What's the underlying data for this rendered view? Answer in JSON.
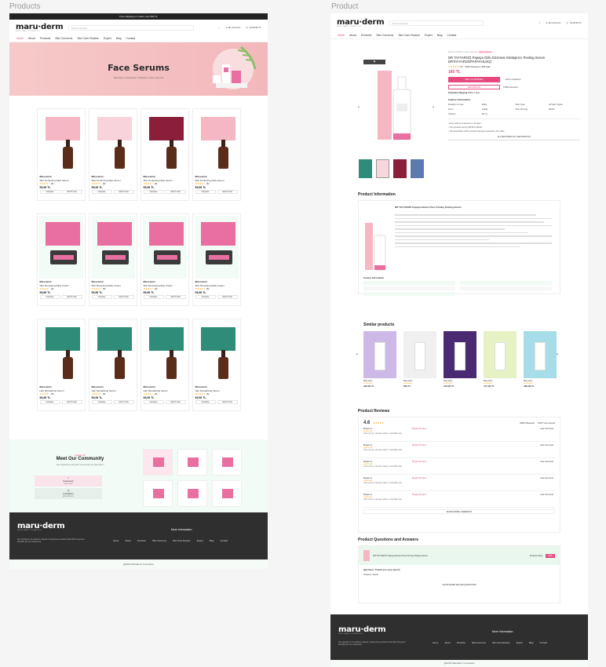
{
  "labels": {
    "left": "Products",
    "right": "Product"
  },
  "topbar": "Free shipping on orders over 500 TL",
  "brand": {
    "name": "maru·derm",
    "sub": "SKIN CARE COSMETICS"
  },
  "header": {
    "search_placeholder": "Search product",
    "account": "My Account",
    "cart": "1249,99 TL"
  },
  "nav_left": [
    "Home",
    "About",
    "Products",
    "Skin Concerns",
    "Skin Care Routine",
    "Expert",
    "Blog",
    "Contact"
  ],
  "banner": {
    "title": "Face Serums",
    "crumb": "Maruderm Cosmetics  /  Products  /  Face Serums"
  },
  "product_rows": [
    {
      "name": "Maru.derm",
      "desc": "Skin Perfecting Daily Serum",
      "price": "59,99 TL",
      "reviews": "(8)"
    },
    {
      "name": "Maru.derm",
      "desc": "Skin Renewing Daily Cream",
      "price": "59,99 TL",
      "reviews": "(8)"
    },
    {
      "name": "Maru.derm",
      "desc": "Hair Revitalizing Serum",
      "price": "59,99 TL",
      "reviews": "(8)"
    }
  ],
  "card_btns": {
    "a": "Compare",
    "b": "Add To Cart"
  },
  "community": {
    "kicker": "Follow Us",
    "title": "Meet Our Community",
    "desc": "Get inspired by the skin community at maru.derm",
    "fb": "Facebook",
    "fb_sub": "maru.derm",
    "ig": "Instagram",
    "ig_sub": "@maru.derm"
  },
  "footer": {
    "tagline": "Our mission is to produce natural, cruelty-free products that offer long-term benefits for our customers.",
    "more": "More Information",
    "links": [
      "Home",
      "About",
      "Products",
      "Skin Concerns",
      "Skin Care Routine",
      "Expert",
      "Blog",
      "Contact"
    ],
    "copyright": "@2023 Maruderm Cosmetics"
  },
  "product": {
    "crumb": "Home / Products / Face Serums",
    "badge": "New Product",
    "title": "DR TAYYAROĞ Papaya Özlü Gözenek Sıkılaştırıcı Peeling Serum DRTAYYAROĞPAPAYAİLİKÇİ",
    "rating": "4.8",
    "reviews": "1549 Reviews",
    "questions": "298 Qas",
    "price": "185 TL",
    "add": "ADD TO BASKET",
    "fav": "FAVOURITES",
    "estimated": "Estimated Shipping",
    "est_val": "Within 3 days",
    "favcount": "13553 Favorites",
    "feat_title": "Feature Information",
    "features": [
      [
        "Duration of Use",
        "Daily"
      ],
      [
        "Skin Firming",
        "Skin Type"
      ],
      [
        "All Skin Types",
        "Form"
      ],
      [
        "Liquid",
        "Volume"
      ],
      [
        "30 ml",
        "Bottle"
      ]
    ],
    "notes": [
      "Free returns of all items in 14 days.",
      "This product sent by DRTAYYAROĞ.",
      "The description of the product has been entered by the seller."
    ],
    "all_features": "ALL FEATURES OF THE PRODUCT",
    "info_title": "Product Information",
    "info_head": "DR TAYYAROĞ Papaya Extract Pore Firming Peeling Serum",
    "sim_title": "Similar products",
    "sim_items": [
      {
        "brand": "Maru.derm",
        "price": "199,99 TL"
      },
      {
        "brand": "Maru.derm",
        "price": "599 TL"
      },
      {
        "brand": "Maru.derm",
        "price": "139,95 TL"
      },
      {
        "brand": "Maru.derm",
        "price": "147,90 TL"
      },
      {
        "brand": "Maru.derm",
        "price": "189,99 TL"
      }
    ],
    "rev_title": "Product Reviews",
    "rev_score": "4.6",
    "rev_count": "4563 Reviews",
    "rev_comments": "2197 Comments",
    "rev_user": "Müşteri A.",
    "rev_tag": "Bought Product",
    "rev_text": "Ürün çok iyi, tavsiye ederim. Kesinlikle alın.",
    "rev_like": "Like Comment",
    "rev_more": "SHOW MORE COMMENTS",
    "qa_title": "Product Questions and Answers",
    "qa_prod": "DR TAYYAROĞ Papaya Extract Pore Firming Peeling Serum",
    "qa_rating": "Product rating",
    "qa_ask": "ASK",
    "qa_q": "Question: Thank you very much!",
    "qa_a": "Answer: Favor",
    "qa_more": "SHOW MORE SELLER QUESTIONS"
  },
  "colors": {
    "pink": "#e64980",
    "dark": "#2f2f2f",
    "mint": "#f2fbf6"
  }
}
